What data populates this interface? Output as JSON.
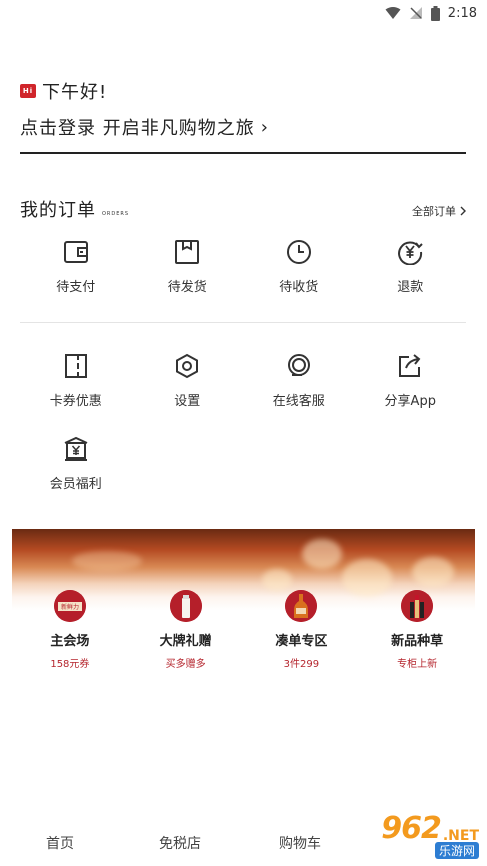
{
  "status_bar": {
    "time": "2:18",
    "icons": [
      "wifi-icon",
      "no-signal-icon",
      "battery-icon"
    ]
  },
  "greeting": {
    "logo_text": "Hi",
    "hello": "下午好!",
    "login_prompt": "点击登录 开启非凡购物之旅",
    "chevron": "›"
  },
  "orders": {
    "title": "我的订单",
    "title_en": "ORDERS",
    "all_label": "全部订单",
    "items": [
      {
        "label": "待支付",
        "icon": "wallet-icon"
      },
      {
        "label": "待发货",
        "icon": "package-icon"
      },
      {
        "label": "待收货",
        "icon": "clock-icon"
      },
      {
        "label": "退款",
        "icon": "refund-yen-icon"
      }
    ]
  },
  "services": {
    "items": [
      {
        "label": "卡券优惠",
        "icon": "coupon-icon"
      },
      {
        "label": "设置",
        "icon": "settings-hex-icon"
      },
      {
        "label": "在线客服",
        "icon": "customer-service-icon"
      },
      {
        "label": "分享App",
        "icon": "share-icon"
      },
      {
        "label": "会员福利",
        "icon": "member-benefit-icon"
      }
    ]
  },
  "promos": [
    {
      "name": "主会场",
      "sub": "158元券",
      "badge_text": "七七嘉年\n新鲜力"
    },
    {
      "name": "大牌礼赠",
      "sub": "买多赠多"
    },
    {
      "name": "凑单专区",
      "sub": "3件299"
    },
    {
      "name": "新品种草",
      "sub": "专柜上新"
    }
  ],
  "bottom_nav": [
    {
      "label": "首页"
    },
    {
      "label": "免税店"
    },
    {
      "label": "购物车"
    }
  ],
  "watermark": {
    "number": "962",
    "net": ".NET",
    "sub": "乐游网"
  },
  "colors": {
    "accent": "#d0252b",
    "promo_sub": "#b5262e",
    "watermark": "#f39a1e"
  }
}
